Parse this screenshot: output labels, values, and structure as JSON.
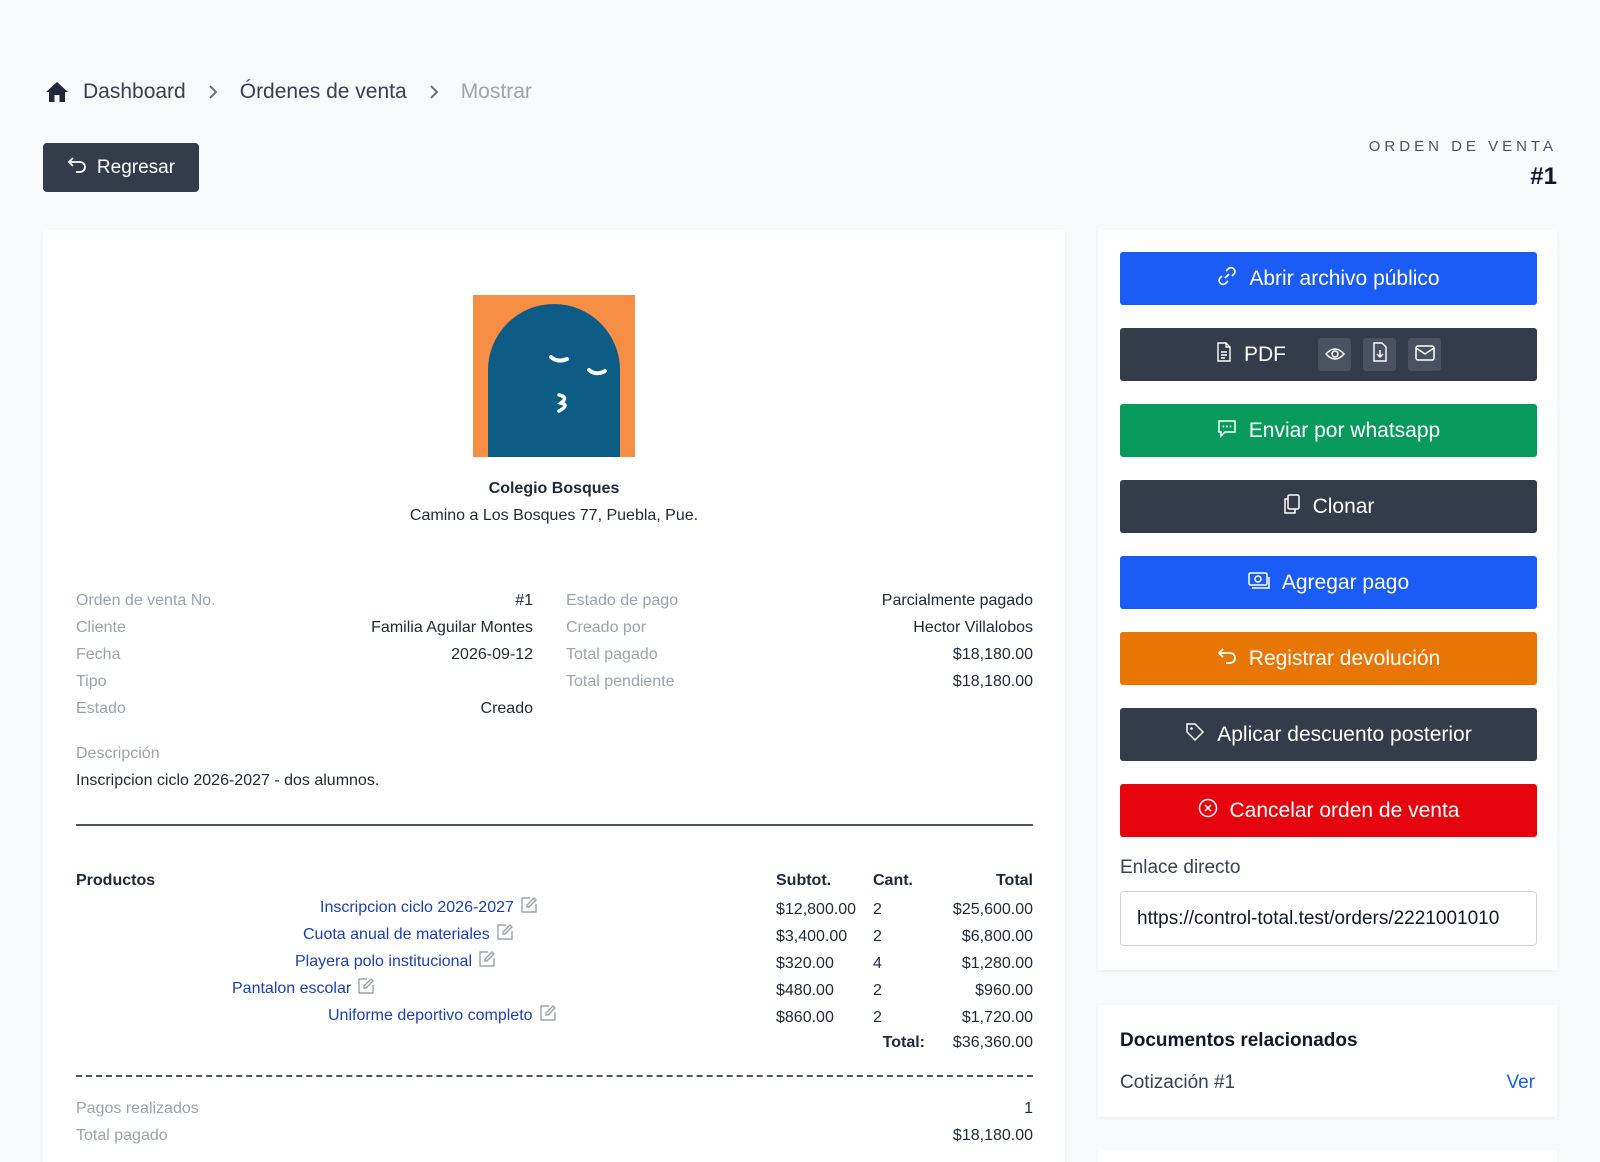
{
  "breadcrumb": {
    "home": "Dashboard",
    "section": "Órdenes de venta",
    "current": "Mostrar"
  },
  "back_button": "Regresar",
  "order_header": {
    "label": "ORDEN DE VENTA",
    "number": "#1"
  },
  "company": {
    "name": "Colegio Bosques",
    "address": "Camino a Los Bosques 77, Puebla, Pue."
  },
  "info_left": [
    {
      "k": "Orden de venta No.",
      "v": "#1"
    },
    {
      "k": "Cliente",
      "v": "Familia Aguilar Montes"
    },
    {
      "k": "Fecha",
      "v": "2026-09-12"
    },
    {
      "k": "Tipo",
      "v": ""
    },
    {
      "k": "Estado",
      "v": "Creado"
    }
  ],
  "info_right": [
    {
      "k": "Estado de pago",
      "v": "Parcialmente pagado"
    },
    {
      "k": "Creado por",
      "v": "Hector Villalobos"
    },
    {
      "k": "Total pagado",
      "v": "$18,180.00"
    },
    {
      "k": "Total pendiente",
      "v": "$18,180.00"
    }
  ],
  "description": {
    "label": "Descripción",
    "value": "Inscripcion ciclo 2026-2027 - dos alumnos."
  },
  "products": {
    "headers": {
      "name": "Productos",
      "subtotal": "Subtot.",
      "qty": "Cant.",
      "total": "Total"
    },
    "rows": [
      {
        "name": "Inscripcion ciclo 2026-2027",
        "subtotal": "$12,800.00",
        "qty": "2",
        "total": "$25,600.00"
      },
      {
        "name": "Cuota anual de materiales",
        "subtotal": "$3,400.00",
        "qty": "2",
        "total": "$6,800.00"
      },
      {
        "name": "Playera polo institucional",
        "subtotal": "$320.00",
        "qty": "4",
        "total": "$1,280.00"
      },
      {
        "name": "Pantalon escolar",
        "subtotal": "$480.00",
        "qty": "2",
        "total": "$960.00"
      },
      {
        "name": "Uniforme deportivo completo",
        "subtotal": "$860.00",
        "qty": "2",
        "total": "$1,720.00"
      }
    ],
    "total_label": "Total:",
    "total_value": "$36,360.00"
  },
  "payments": [
    {
      "k": "Pagos realizados",
      "v": "1"
    },
    {
      "k": "Total pagado",
      "v": "$18,180.00"
    }
  ],
  "actions": {
    "open_public": "Abrir archivo público",
    "pdf": "PDF",
    "whatsapp": "Enviar por whatsapp",
    "clone": "Clonar",
    "add_payment": "Agregar pago",
    "refund": "Registrar devolución",
    "discount": "Aplicar descuento posterior",
    "cancel": "Cancelar orden de venta"
  },
  "direct_link": {
    "label": "Enlace directo",
    "value": "https://control-total.test/orders/2221001010"
  },
  "related_docs": {
    "title": "Documentos relacionados",
    "item": "Cotización #1",
    "link": "Ver"
  },
  "colors": {
    "primary_blue": "#1a5cf5",
    "dark": "#343c4b",
    "green": "#079a5b",
    "orange": "#e87604",
    "red": "#e5040e",
    "link_blue": "#1e40af"
  },
  "icons": [
    "home-icon",
    "chevron-right-icon",
    "undo-icon",
    "link-icon",
    "file-icon",
    "eye-icon",
    "download-icon",
    "mail-icon",
    "chat-icon",
    "copy-icon",
    "money-icon",
    "tag-icon",
    "x-circle-icon",
    "edit-icon"
  ]
}
